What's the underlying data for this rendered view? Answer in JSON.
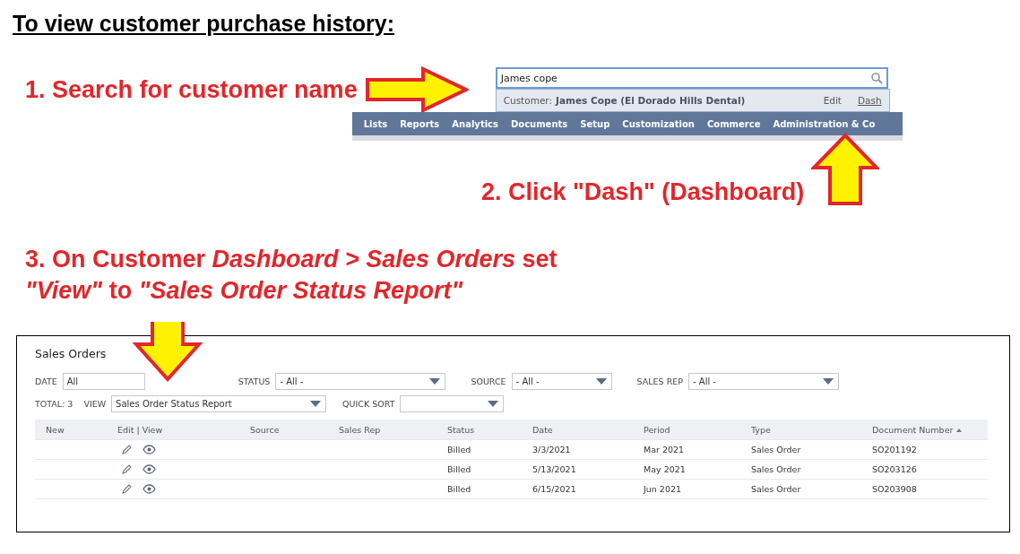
{
  "title": "To view customer purchase history:",
  "steps": [
    {
      "text": "1. Search for customer name"
    },
    {
      "text": "2. Click \"Dash\" (Dashboard)"
    },
    {
      "text": "3. On Customer *Dashboard > Sales Orders*  set",
      "text_2": "*\"View\"* to *\"Sales Order Status Report\"*"
    }
  ],
  "search": {
    "value": "James cope",
    "suggestion": {
      "label": "Customer:",
      "name": "James Cope (El Dorado Hills Dental)",
      "actions": [
        {
          "label": "Edit",
          "hovered": false
        },
        {
          "label": "Dash",
          "hovered": true
        }
      ]
    }
  },
  "nav": [
    "Lists",
    "Reports",
    "Analytics",
    "Documents",
    "Setup",
    "Customization",
    "Commerce",
    "Administration & Co"
  ],
  "panel": {
    "title": "Sales Orders",
    "filters": [
      {
        "label": "DATE",
        "value": "All",
        "kind": "text"
      },
      {
        "label": "STATUS",
        "value": "- All -",
        "kind": "select"
      },
      {
        "label": "SOURCE",
        "value": "- All -",
        "kind": "select"
      },
      {
        "label": "SALES REP",
        "value": "- All -",
        "kind": "select"
      }
    ],
    "total": "TOTAL: 3",
    "view": {
      "label": "VIEW",
      "value": "Sales Order Status Report"
    },
    "quick_sort": {
      "label": "QUICK SORT"
    },
    "columns": [
      {
        "label": "New",
        "sorted": false
      },
      {
        "label": "Edit | View",
        "sorted": false
      },
      {
        "label": "Source",
        "sorted": false
      },
      {
        "label": "Sales Rep",
        "sorted": false
      },
      {
        "label": "Status",
        "sorted": false
      },
      {
        "label": "Date",
        "sorted": false
      },
      {
        "label": "Period",
        "sorted": false
      },
      {
        "label": "Type",
        "sorted": false
      },
      {
        "label": "Document Number",
        "sorted": true
      }
    ],
    "rows": [
      {
        "status": "Billed",
        "date": "3/3/2021",
        "period": "Mar 2021",
        "type": "Sales Order",
        "document_number": "SO201192"
      },
      {
        "status": "Billed",
        "date": "5/13/2021",
        "period": "May 2021",
        "type": "Sales Order",
        "document_number": "SO203126"
      },
      {
        "status": "Billed",
        "date": "6/15/2021",
        "period": "Jun 2021",
        "type": "Sales Order",
        "document_number": "SO203908"
      }
    ]
  }
}
